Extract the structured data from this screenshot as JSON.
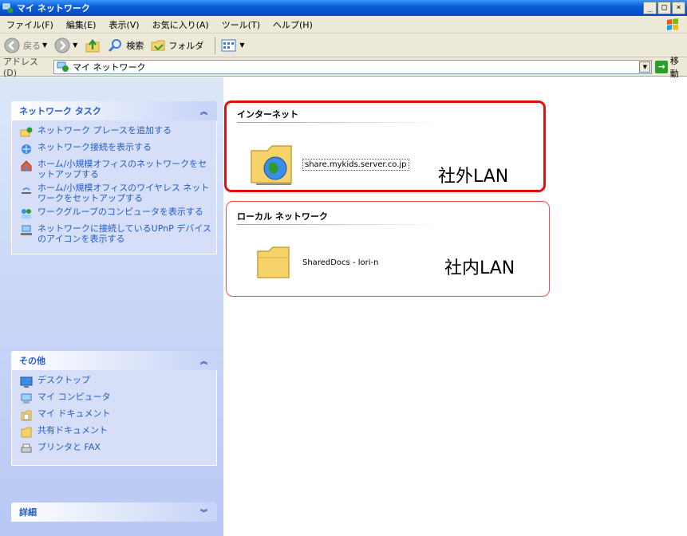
{
  "window": {
    "title": "マイ ネットワーク",
    "buttons": [
      "_",
      "□",
      "×"
    ]
  },
  "menu": [
    "ファイル(F)",
    "編集(E)",
    "表示(V)",
    "お気に入り(A)",
    "ツール(T)",
    "ヘルプ(H)"
  ],
  "toolbar": {
    "back": "戻る",
    "search": "検索",
    "folders": "フォルダ"
  },
  "address": {
    "label": "アドレス(D)",
    "value": "マイ ネットワーク",
    "go": "移動"
  },
  "panels": {
    "network_tasks": {
      "title": "ネットワーク タスク",
      "items": [
        "ネットワーク プレースを追加する",
        "ネットワーク接続を表示する",
        "ホーム/小規模オフィスのネットワークをセットアップする",
        "ホーム/小規模オフィスのワイヤレス ネットワークをセットアップする",
        "ワークグループのコンピュータを表示する",
        "ネットワークに接続しているUPnP デバイスのアイコンを表示する"
      ]
    },
    "other": {
      "title": "その他",
      "items": [
        "デスクトップ",
        "マイ コンピュータ",
        "マイ ドキュメント",
        "共有ドキュメント",
        "プリンタと FAX"
      ]
    },
    "details": {
      "title": "詳細"
    }
  },
  "content": {
    "internet": {
      "header": "インターネット",
      "item": "share.mykids.server.co.jp",
      "label": "社外LAN"
    },
    "local": {
      "header": "ローカル ネットワーク",
      "item": "SharedDocs - lori-n",
      "label": "社内LAN"
    }
  },
  "colors": {
    "title_blue": "#0a5fd8",
    "task_link": "#215dc6",
    "annotation_red": "#e01010"
  }
}
